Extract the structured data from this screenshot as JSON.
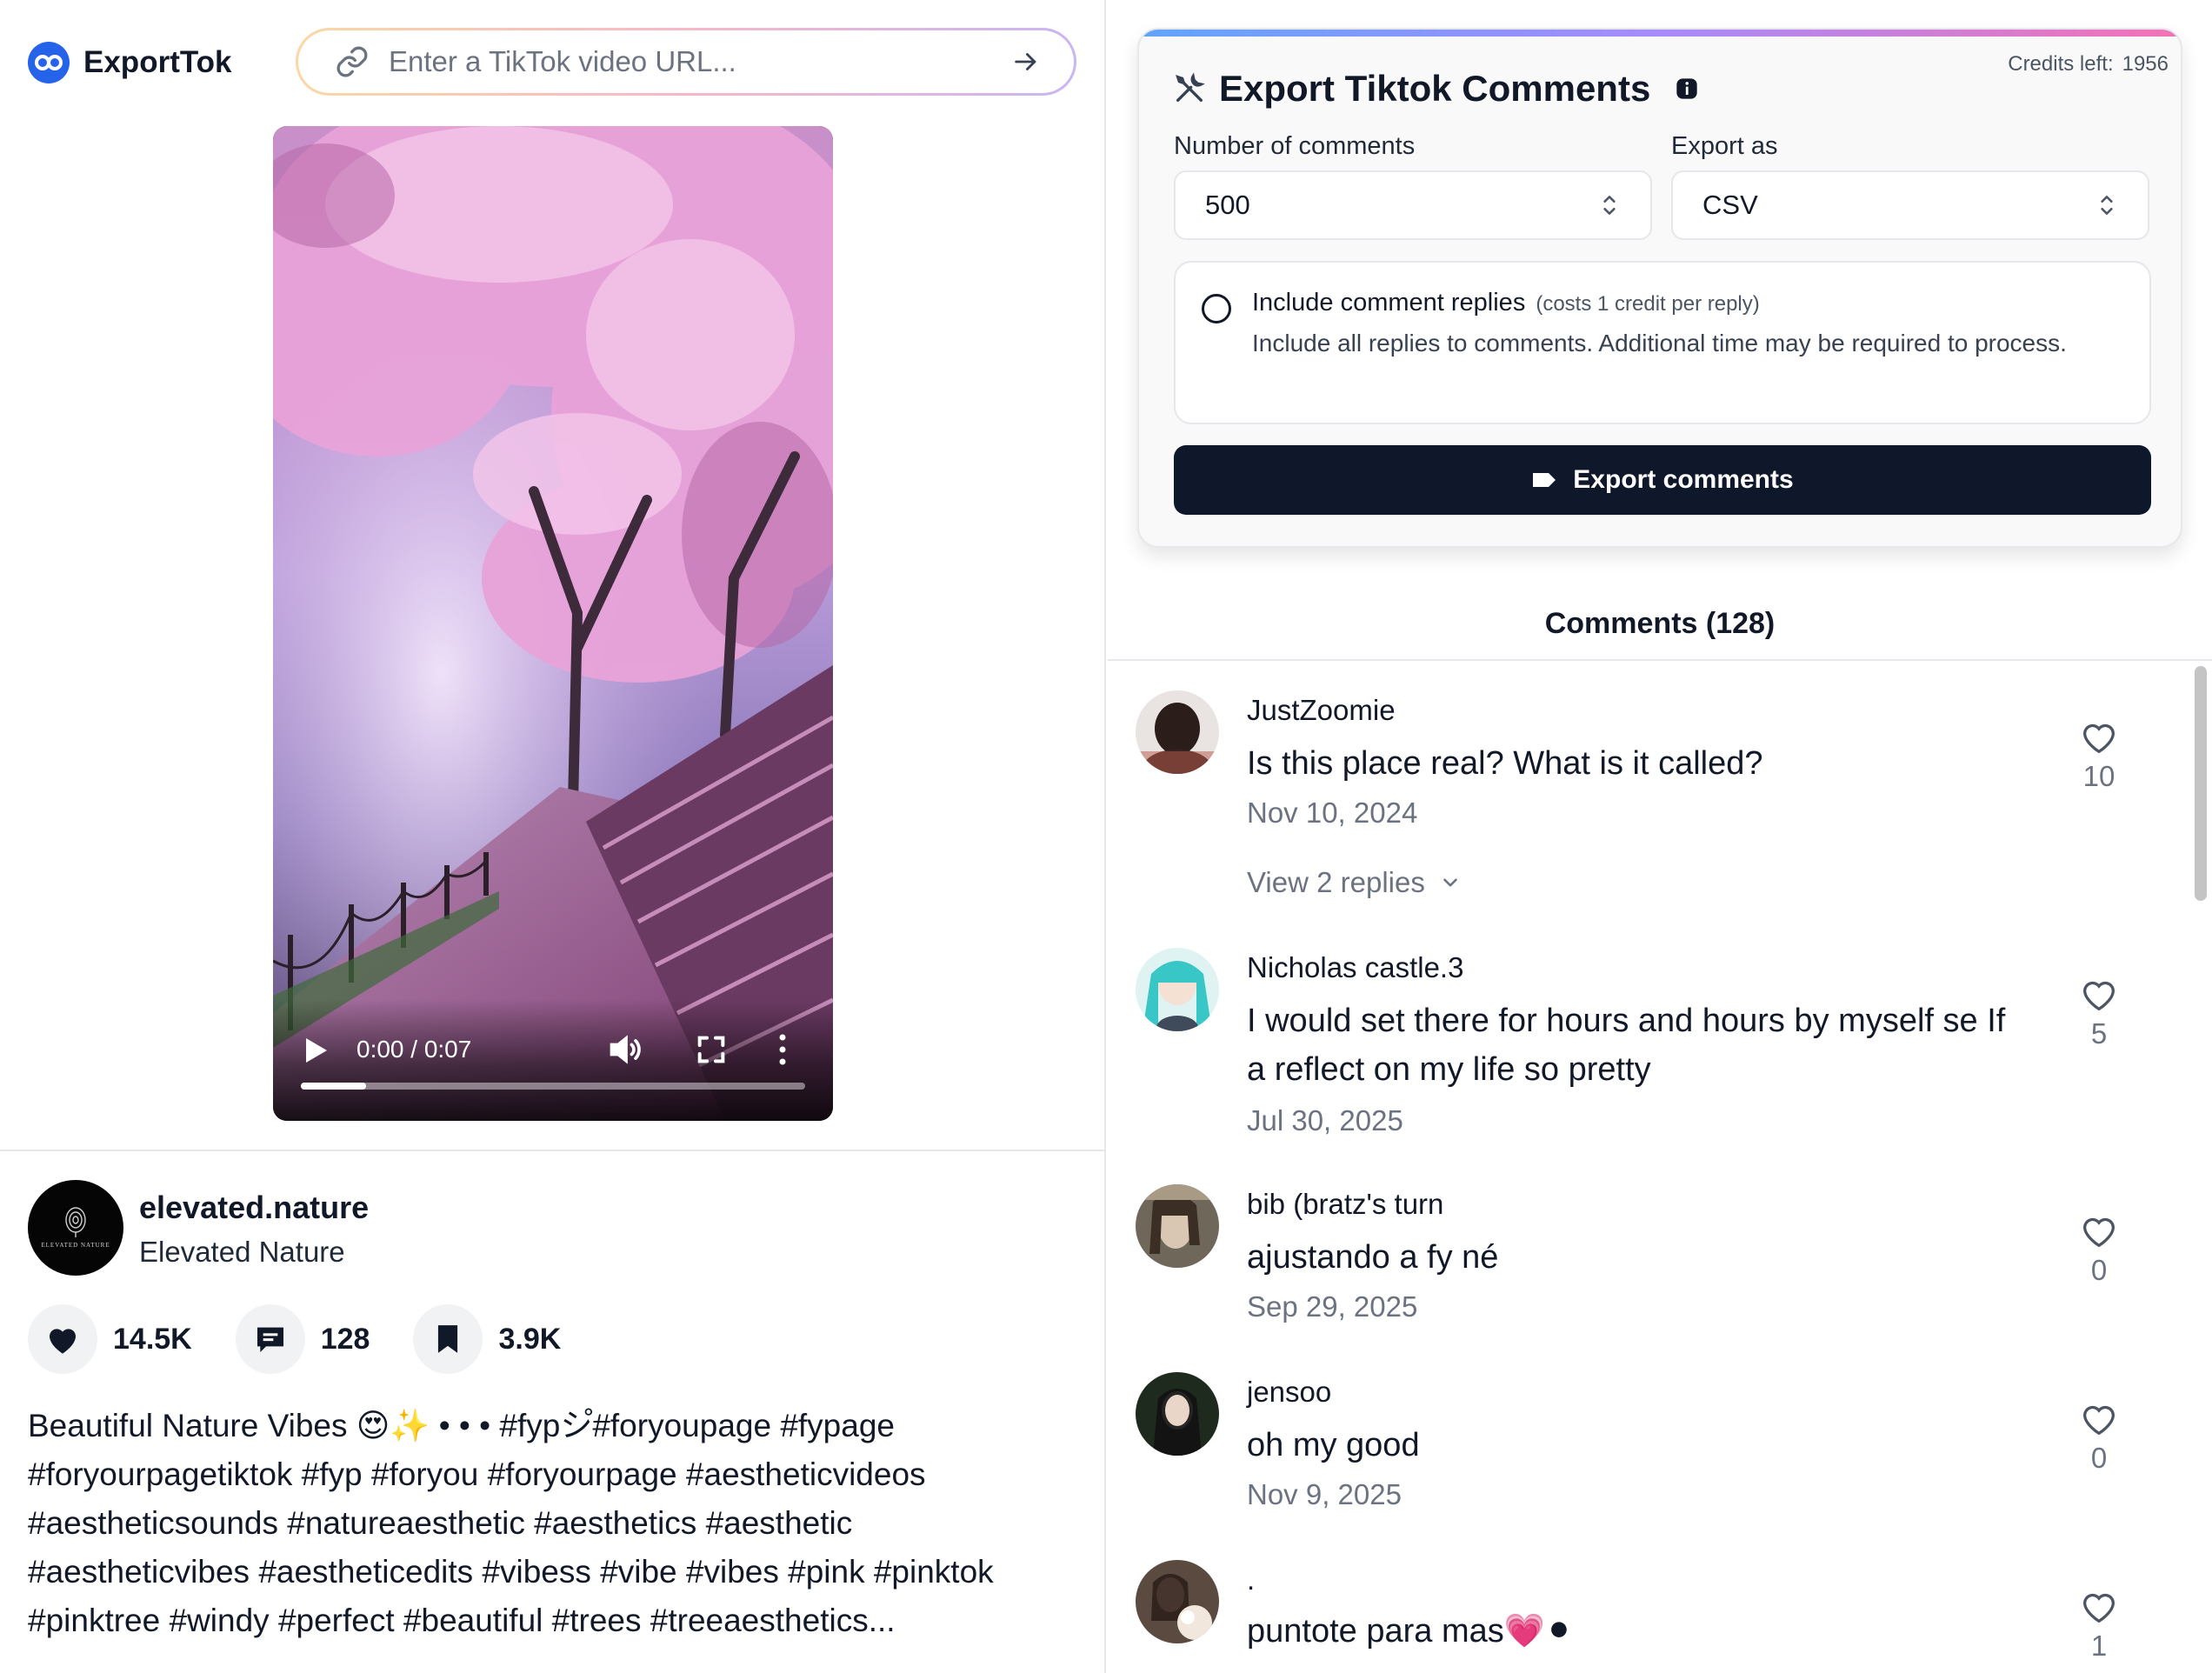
{
  "app": {
    "brand_name": "ExportTok",
    "url_placeholder": "Enter a TikTok video URL..."
  },
  "video": {
    "time": "0:00 / 0:07",
    "progress_fraction": 0.13
  },
  "author": {
    "handle": "elevated.nature",
    "display_name": "Elevated Nature",
    "avatar_text": "ELEVATED NATURE"
  },
  "stats": {
    "likes": "14.5K",
    "comments": "128",
    "saves": "3.9K"
  },
  "description": "Beautiful Nature Vibes 😍✨ • • • #fypシ゚#foryoupage #fypage #foryourpagetiktok #fyp #foryou #foryourpage #aestheticvideos #aestheticsounds #natureaesthetic #aesthetics #aesthetic #aestheticvibes #aestheticedits #vibess #vibe #vibes #pink #pinktok #pinktree #windy #perfect #beautiful #trees #treeaesthetics...",
  "export": {
    "credits_label": "Credits left:",
    "credits_value": "1956",
    "title": "Export Tiktok Comments",
    "count_label": "Number of comments",
    "count_value": "500",
    "format_label": "Export as",
    "format_value": "CSV",
    "replies_title": "Include comment replies",
    "replies_cost": "(costs 1 credit per reply)",
    "replies_desc": "Include all replies to comments. Additional time may be required to process.",
    "button_label": "Export comments"
  },
  "comments_header": "Comments (128)",
  "comments": [
    {
      "user": "JustZoomie",
      "text": "Is this place real? What is it called?",
      "date": "Nov 10, 2024",
      "likes": "10",
      "replies": "View 2 replies"
    },
    {
      "user": "Nicholas castle.3",
      "text": "I would set there for hours and hours by myself se If a reflect on my life so pretty",
      "date": "Jul 30, 2025",
      "likes": "5"
    },
    {
      "user": "bib (bratz's turn",
      "text": "ajustando a fy né",
      "date": "Sep 29, 2025",
      "likes": "0"
    },
    {
      "user": "jensoo",
      "text": "oh my good",
      "date": "Nov 9, 2025",
      "likes": "0"
    },
    {
      "user": ".",
      "text": "puntote para mas💗⚫",
      "date": "",
      "likes": "1"
    }
  ],
  "colors": {
    "brand_blue": "#2563eb",
    "export_button": "#0f172a",
    "muted_text": "#6b7280"
  },
  "icons": [
    "brand-logo-icon",
    "link-icon",
    "arrow-right-icon",
    "play-icon",
    "volume-icon",
    "fullscreen-icon",
    "more-vertical-icon",
    "heart-icon",
    "comment-icon",
    "bookmark-icon",
    "tools-icon",
    "info-icon",
    "chevron-updown-icon",
    "tag-icon",
    "chevron-down-icon"
  ]
}
